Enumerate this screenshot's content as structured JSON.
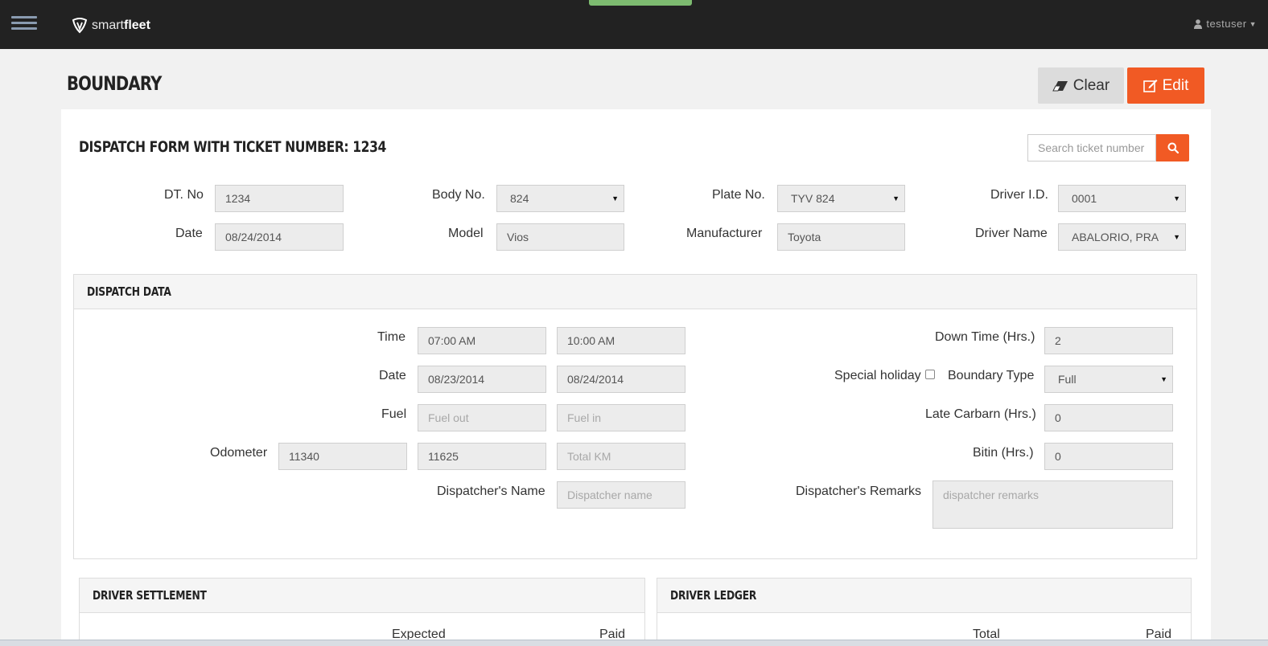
{
  "topbar": {
    "brand_smart": "smart",
    "brand_fleet": "fleet",
    "user": "testuser",
    "hamburger_icon": "menu-icon",
    "user_icon": "user-icon"
  },
  "page": {
    "title": "BOUNDARY",
    "clear_label": "Clear",
    "edit_label": "Edit",
    "accent_color": "#f15a24"
  },
  "form": {
    "title": "DISPATCH FORM WITH TICKET NUMBER: 1234",
    "search_placeholder": "Search ticket number",
    "dt_no_label": "DT. No",
    "dt_no_value": "1234",
    "date_label": "Date",
    "date_value": "08/24/2014",
    "body_no_label": "Body No.",
    "body_no_value": "824",
    "model_label": "Model",
    "model_value": "Vios",
    "plate_no_label": "Plate No.",
    "plate_no_value": "TYV 824",
    "manufacturer_label": "Manufacturer",
    "manufacturer_value": "Toyota",
    "driver_id_label": "Driver I.D.",
    "driver_id_value": "0001",
    "driver_name_label": "Driver Name",
    "driver_name_value": "ABALORIO, PRAX"
  },
  "dispatch": {
    "header": "DISPATCH DATA",
    "time_label": "Time",
    "time_out": "07:00 AM",
    "time_in": "10:00 AM",
    "date_label": "Date",
    "date_out": "08/23/2014",
    "date_in": "08/24/2014",
    "fuel_label": "Fuel",
    "fuel_out_placeholder": "Fuel out",
    "fuel_in_placeholder": "Fuel in",
    "odometer_label": "Odometer",
    "odometer_a": "11340",
    "odometer_b": "11625",
    "total_km_placeholder": "Total KM",
    "dispatcher_name_label": "Dispatcher's Name",
    "dispatcher_name_placeholder": "Dispatcher name",
    "down_time_label": "Down Time (Hrs.)",
    "down_time_value": "2",
    "special_holiday_label": "Special holiday",
    "boundary_type_label": "Boundary Type",
    "boundary_type_value": "Full",
    "late_carbarn_label": "Late Carbarn (Hrs.)",
    "late_carbarn_value": "0",
    "bitin_label": "Bitin (Hrs.)",
    "bitin_value": "0",
    "remarks_label": "Dispatcher's Remarks",
    "remarks_placeholder": "dispatcher remarks"
  },
  "settlement": {
    "header": "DRIVER SETTLEMENT",
    "col_expected": "Expected",
    "col_paid": "Paid"
  },
  "ledger": {
    "header": "DRIVER LEDGER",
    "col_total": "Total",
    "col_paid": "Paid"
  }
}
